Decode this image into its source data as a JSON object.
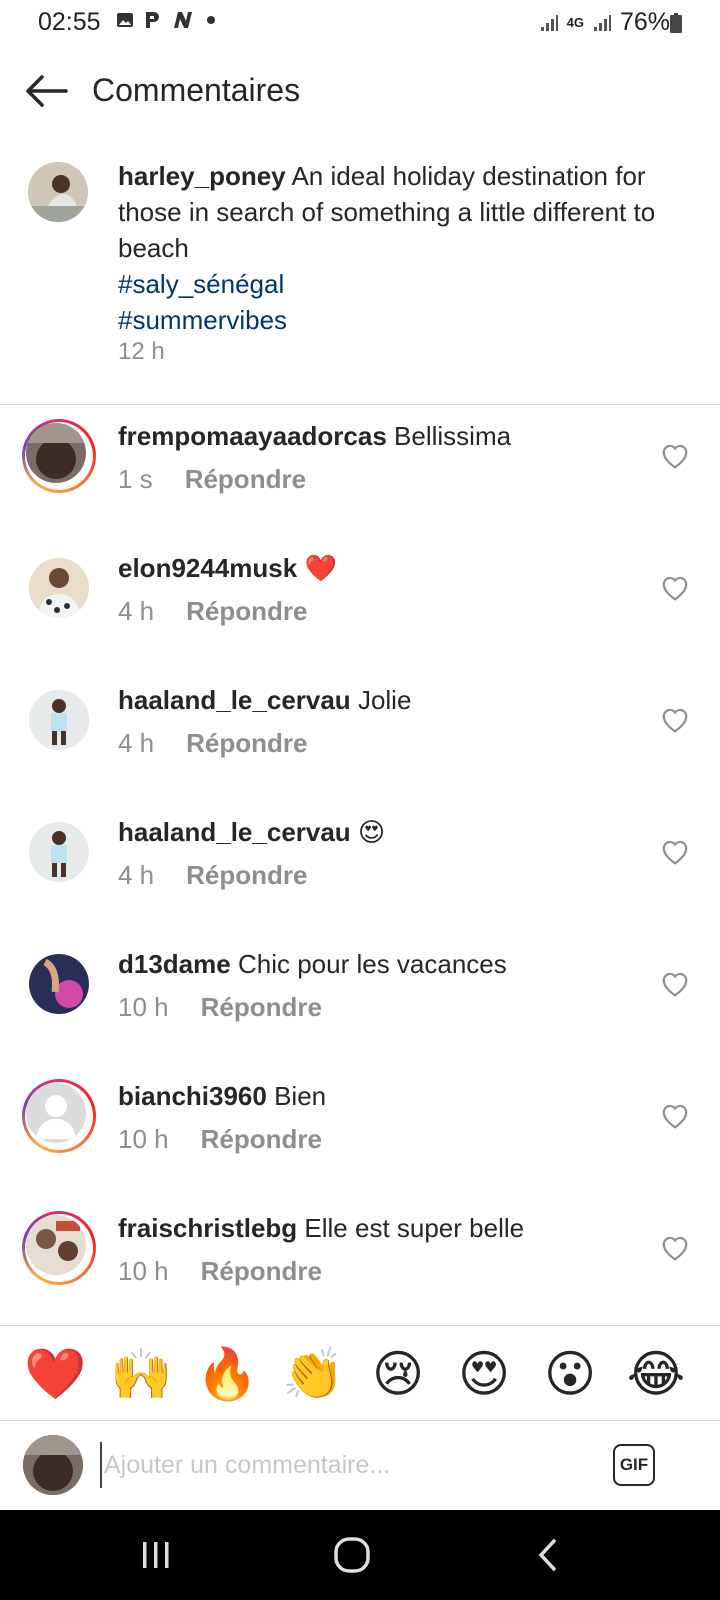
{
  "status_bar": {
    "time": "02:55",
    "network": "4G",
    "battery": "76%"
  },
  "header": {
    "title": "Commentaires"
  },
  "caption": {
    "username": "harley_poney",
    "text": "An ideal holiday destination for those in search of something a little different to beach",
    "hashtags": [
      "#saly_sénégal",
      "#summervibes"
    ],
    "time": "12 h"
  },
  "comments": [
    {
      "username": "frempomaayaadorcas",
      "text": "Bellissima",
      "time": "1 s",
      "reply_label": "Répondre"
    },
    {
      "username": "elon9244musk",
      "text": "❤️",
      "time": "4 h",
      "reply_label": "Répondre"
    },
    {
      "username": "haaland_le_cervau",
      "text": "Jolie",
      "time": "4 h",
      "reply_label": "Répondre"
    },
    {
      "username": "haaland_le_cervau",
      "text": "😍",
      "time": "4 h",
      "reply_label": "Répondre"
    },
    {
      "username": "d13dame",
      "text": "Chic pour les vacances",
      "time": "10 h",
      "reply_label": "Répondre"
    },
    {
      "username": "bianchi3960",
      "text": "Bien",
      "time": "10 h",
      "reply_label": "Répondre"
    },
    {
      "username": "fraischristlebg",
      "text": "Elle est super belle",
      "time": "10 h",
      "reply_label": "Répondre"
    }
  ],
  "emoji_bar": [
    "❤️",
    "🙌",
    "🔥",
    "👏",
    "😢",
    "😍",
    "😮",
    "😂"
  ],
  "composer": {
    "placeholder": "Ajouter un commentaire...",
    "gif_label": "GIF"
  }
}
